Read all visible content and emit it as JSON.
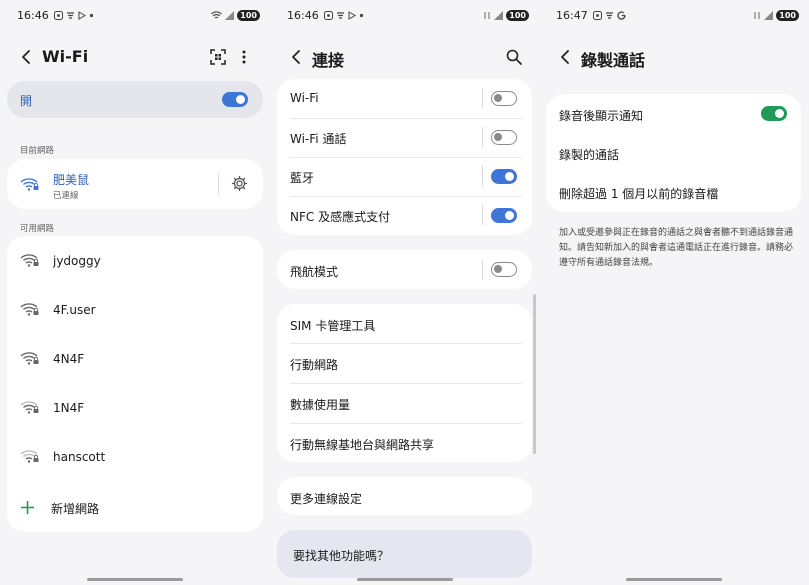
{
  "panel1": {
    "status": {
      "time": "16:46",
      "battery": "100"
    },
    "title": "Wi-Fi",
    "master": {
      "label": "開",
      "on": true
    },
    "current_section": "目前網路",
    "current": {
      "name": "肥美鼠",
      "status": "已連線"
    },
    "available_section": "可用網路",
    "networks": [
      {
        "name": "jydoggy"
      },
      {
        "name": "4F.user"
      },
      {
        "name": "4N4F"
      },
      {
        "name": "1N4F"
      },
      {
        "name": "hanscott"
      }
    ],
    "add_network": "新增網路"
  },
  "panel2": {
    "status": {
      "time": "16:46",
      "battery": "100"
    },
    "title": "連接",
    "group1": [
      {
        "label": "Wi-Fi",
        "on": false
      },
      {
        "label": "Wi-Fi 通話",
        "on": false
      },
      {
        "label": "藍牙",
        "on": true
      },
      {
        "label": "NFC 及感應式支付",
        "on": true
      }
    ],
    "group2": [
      {
        "label": "飛航模式",
        "on": false
      }
    ],
    "group3": [
      {
        "label": "SIM 卡管理工具"
      },
      {
        "label": "行動網路"
      },
      {
        "label": "數據使用量"
      },
      {
        "label": "行動無線基地台與網路共享"
      }
    ],
    "more": "更多連線設定",
    "looking": "要找其他功能嗎？"
  },
  "panel3": {
    "status": {
      "time": "16:47",
      "battery": "100"
    },
    "title": "錄製通話",
    "items": [
      {
        "label": "錄音後顯示通知",
        "on": true
      },
      {
        "label": "錄製的通話"
      },
      {
        "label": "刪除超過 1 個月以前的錄音檔"
      }
    ],
    "hint": "加入或受邀參與正在錄音的通話之與會者聽不到通話錄音通知。請告知新加入的與會者這通電話正在進行錄音。請務必遵守所有通話錄音法規。"
  },
  "colors": {
    "accent_blue": "#3e76d8",
    "accent_green": "#1f9a59",
    "background": "#f5f5f7"
  }
}
